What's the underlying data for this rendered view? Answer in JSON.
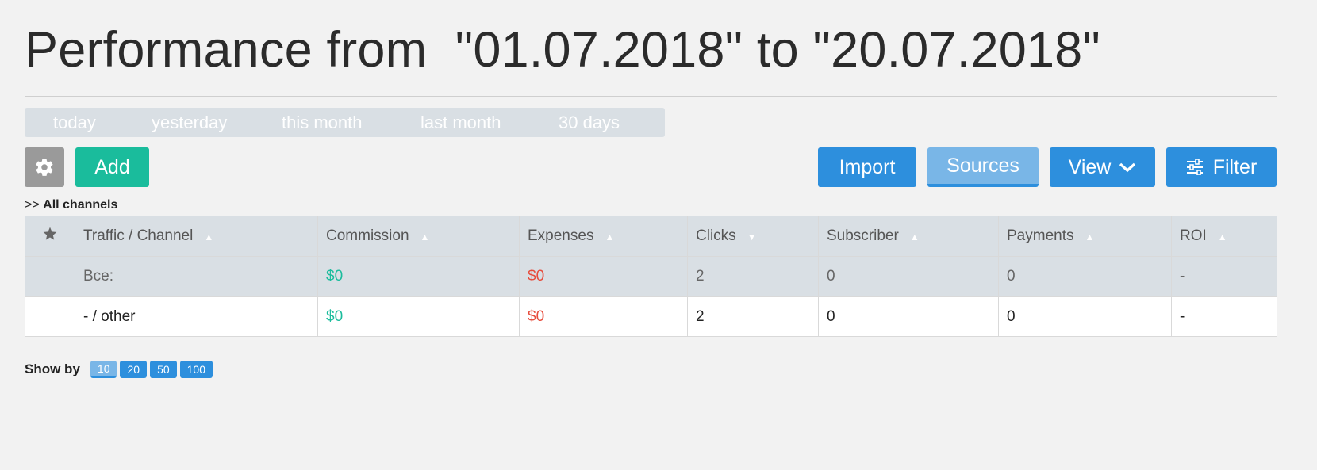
{
  "header": {
    "title": "Performance from  \"01.07.2018\" to \"20.07.2018\""
  },
  "date_ranges": [
    "today",
    "yesterday",
    "this month",
    "last month",
    "30 days"
  ],
  "toolbar": {
    "settings_icon": "gear-icon",
    "add_label": "Add",
    "import_label": "Import",
    "sources_label": "Sources",
    "view_label": "View",
    "view_icon": "chevron-down-icon",
    "filter_label": "Filter",
    "filter_icon": "sliders-icon"
  },
  "breadcrumb": {
    "prefix": ">>",
    "current": "All channels"
  },
  "table": {
    "columns": [
      "Traffic / Channel",
      "Commission",
      "Expenses",
      "Clicks",
      "Subscriber",
      "Payments",
      "ROI"
    ],
    "sort_directions": [
      "up",
      "up",
      "up",
      "down",
      "up",
      "up",
      "up"
    ],
    "total": {
      "label": "Все:",
      "commission": "$0",
      "expenses": "$0",
      "clicks": "2",
      "subscriber": "0",
      "payments": "0",
      "roi": "-"
    },
    "rows": [
      {
        "label": "- / other",
        "commission": "$0",
        "expenses": "$0",
        "clicks": "2",
        "subscriber": "0",
        "payments": "0",
        "roi": "-"
      }
    ]
  },
  "pagination": {
    "label": "Show by",
    "options": [
      "10",
      "20",
      "50",
      "100"
    ],
    "active": "10"
  },
  "colors": {
    "accent": "#2d8fdd",
    "add": "#1abc9c",
    "positive": "#1abc9c",
    "negative": "#e74c3c"
  }
}
